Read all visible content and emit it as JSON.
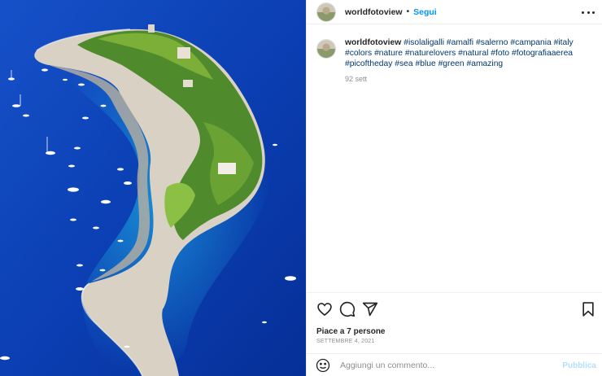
{
  "post": {
    "username": "worldfotoview",
    "follow_label": "Segui",
    "more_icon": "more-horizontal-icon",
    "caption": {
      "username": "worldfotoview",
      "hashtags": [
        "#isolaligalli",
        "#amalfi",
        "#salerno",
        "#campania",
        "#italy",
        "#colors",
        "#nature",
        "#naturelovers",
        "#natural",
        "#foto",
        "#fotografiaaerea",
        "#picoftheday",
        "#sea",
        "#blue",
        "#green",
        "#amazing"
      ],
      "time": "92 sett"
    },
    "actions": {
      "like_icon": "heart-icon",
      "comment_icon": "comment-icon",
      "share_icon": "share-icon",
      "save_icon": "bookmark-icon"
    },
    "likes_text": "Piace a 7 persone",
    "date": "SETTEMBRE 4, 2021",
    "comment_box": {
      "emoji_icon": "emoji-icon",
      "placeholder": "Aggiungi un commento...",
      "publish_label": "Pubblica"
    },
    "colors": {
      "link": "#0095f6",
      "hashtag": "#00376b",
      "publish_disabled": "#b2dffc",
      "sea": "#0a3db0"
    }
  }
}
